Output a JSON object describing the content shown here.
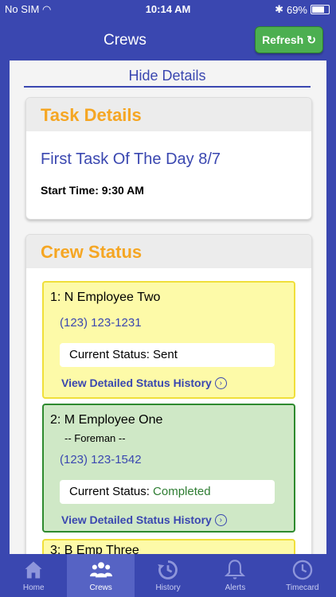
{
  "status_bar": {
    "carrier": "No SIM",
    "time": "10:14 AM",
    "battery": "69%"
  },
  "nav": {
    "title": "Crews",
    "refresh_label": "Refresh"
  },
  "hide_details_label": "Hide Details",
  "task_card": {
    "header": "Task Details",
    "task_name": "First Task Of The Day 8/7",
    "start_time": "Start Time: 9:30 AM"
  },
  "crew_card": {
    "header": "Crew Status",
    "crew": [
      {
        "name": "1: N Employee Two",
        "role": "",
        "phone": "(123) 123-1231",
        "status_label": "Current Status: ",
        "status_value": "Sent",
        "history_label": "View Detailed Status History",
        "color": "#fdfaa8"
      },
      {
        "name": "2: M Employee One",
        "role": "-- Foreman --",
        "phone": "(123) 123-1542",
        "status_label": "Current Status: ",
        "status_value": "Completed",
        "history_label": "View Detailed Status History",
        "color": "#cfe8c6"
      },
      {
        "name": "3: B Emp Three",
        "role": "",
        "phone": "",
        "status_label": "",
        "status_value": "",
        "history_label": "",
        "color": "#fdfaa8"
      }
    ]
  },
  "tabs": [
    {
      "label": "Home",
      "icon": "home-icon"
    },
    {
      "label": "Crews",
      "icon": "crews-icon"
    },
    {
      "label": "History",
      "icon": "history-icon"
    },
    {
      "label": "Alerts",
      "icon": "bell-icon"
    },
    {
      "label": "Timecard",
      "icon": "clock-icon"
    }
  ],
  "colors": {
    "primary": "#3a47b0",
    "accent": "#f5a623",
    "refresh": "#4caf50"
  }
}
